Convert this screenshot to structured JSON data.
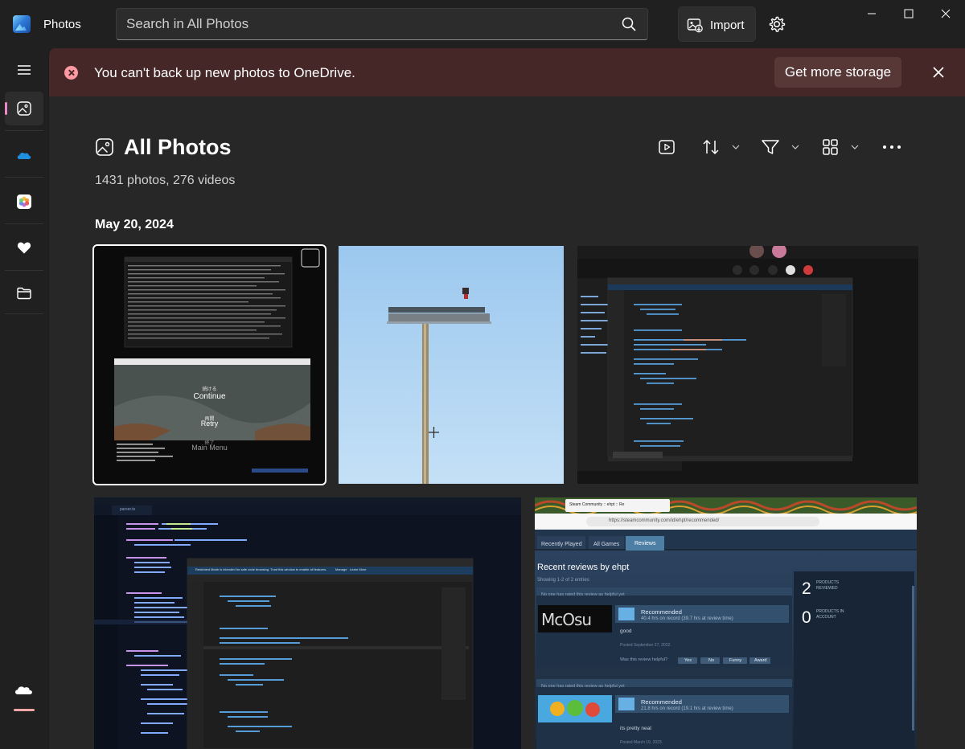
{
  "app": {
    "title": "Photos"
  },
  "search": {
    "placeholder": "Search in All Photos",
    "value": ""
  },
  "toolbar": {
    "import_label": "Import"
  },
  "banner": {
    "message": "You can't back up new photos to OneDrive.",
    "button_label": "Get more storage"
  },
  "rail": {
    "items": [
      {
        "name": "menu",
        "icon": "hamburger-icon"
      },
      {
        "name": "gallery",
        "icon": "gallery-icon",
        "active": true
      },
      {
        "name": "onedrive",
        "icon": "onedrive-cloud-icon"
      },
      {
        "name": "icloud",
        "icon": "icloud-photos-icon"
      },
      {
        "name": "favorites",
        "icon": "heart-icon"
      },
      {
        "name": "folders",
        "icon": "folder-icon"
      },
      {
        "name": "onedrive-storage",
        "icon": "cloud-storage-icon"
      }
    ]
  },
  "header": {
    "title": "All Photos",
    "count": "1431 photos, 276 videos",
    "date_group": "May 20, 2024",
    "tools": [
      "slideshow-icon",
      "sort-icon",
      "filter-icon",
      "view-layout-icon",
      "more-icon"
    ]
  },
  "photos": [
    {
      "type": "screenshot-terminal-game",
      "selected": true,
      "texts": {
        "continue_jp": "続ける",
        "continue": "Continue",
        "retry_jp": "再開",
        "retry": "Retry",
        "menu_jp": "終了",
        "menu": "Main Menu"
      }
    },
    {
      "type": "pixel-art-sky"
    },
    {
      "type": "screenshot-vscode-call"
    },
    {
      "type": "screenshot-code-editor",
      "texts": {
        "tab": "parser.ts",
        "restricted": "Restricted Mode is intended for safe code browsing. Trust this window to enable all features.",
        "manage": "Manage",
        "learn_more": "Learn More"
      }
    },
    {
      "type": "screenshot-steam-reviews",
      "texts": {
        "tab_title": "Steam Community :: ehpt :: Re",
        "url": "https://steamcommunity.com/id/ehpt/recommended/",
        "nav_recently": "Recently Played",
        "nav_all": "All Games",
        "nav_reviews": "Reviews",
        "heading": "Recent reviews by ehpt",
        "showing": "Showing 1-2 of 2 entries",
        "helpful_none": "No one has rated this review as helpful yet",
        "recommended": "Recommended",
        "hrs1": "40.4 hrs on record (39.7 hrs at review time)",
        "review1": "good",
        "posted1": "Posted September 27, 2022.",
        "helpful_q": "Was this review helpful?",
        "yes": "Yes",
        "no": "No",
        "funny": "Funny",
        "award": "Award",
        "hrs2": "21.8 hrs on record (19.1 hrs at review time)",
        "review2": "its pretty neat",
        "posted2": "Posted March 19, 2023.",
        "products_reviewed_n": "2",
        "products_reviewed": "PRODUCTS REVIEWED",
        "products_account_n": "0",
        "products_account": "PRODUCTS IN ACCOUNT",
        "game1_logo": "McOsu"
      }
    }
  ]
}
